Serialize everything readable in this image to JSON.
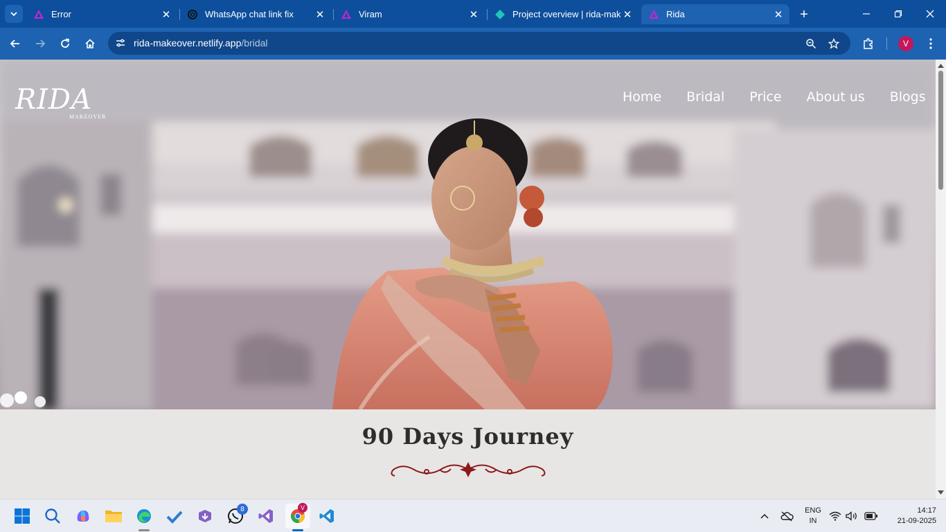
{
  "browser": {
    "tabs": [
      {
        "title": "Error",
        "icon": "app-logo-icon",
        "active": false
      },
      {
        "title": "WhatsApp chat link fix",
        "icon": "openai-icon",
        "active": false
      },
      {
        "title": "Viram",
        "icon": "app-logo-icon",
        "active": false
      },
      {
        "title": "Project overview | rida-make",
        "icon": "netlify-icon",
        "active": false
      },
      {
        "title": "Rida",
        "icon": "app-logo-icon",
        "active": true
      }
    ],
    "url_host": "rida-makeover.netlify.app",
    "url_path": "/bridal",
    "profile_initial": "V"
  },
  "site": {
    "logo_main": "RIDA",
    "logo_sub": "MAKEOVER",
    "nav": [
      "Home",
      "Bridal",
      "Price",
      "About us",
      "Blogs"
    ],
    "section_title": "90 Days Journey"
  },
  "taskbar": {
    "whatsapp_badge": "8",
    "chrome_badge": "V",
    "lang_top": "ENG",
    "lang_bottom": "IN",
    "time": "14:17",
    "date": "21-09-2025"
  },
  "colors": {
    "tabstrip": "#0d4f9c",
    "toolbar": "#1e63b1",
    "ornament": "#8b1a1a",
    "accent": "#0067c0"
  }
}
